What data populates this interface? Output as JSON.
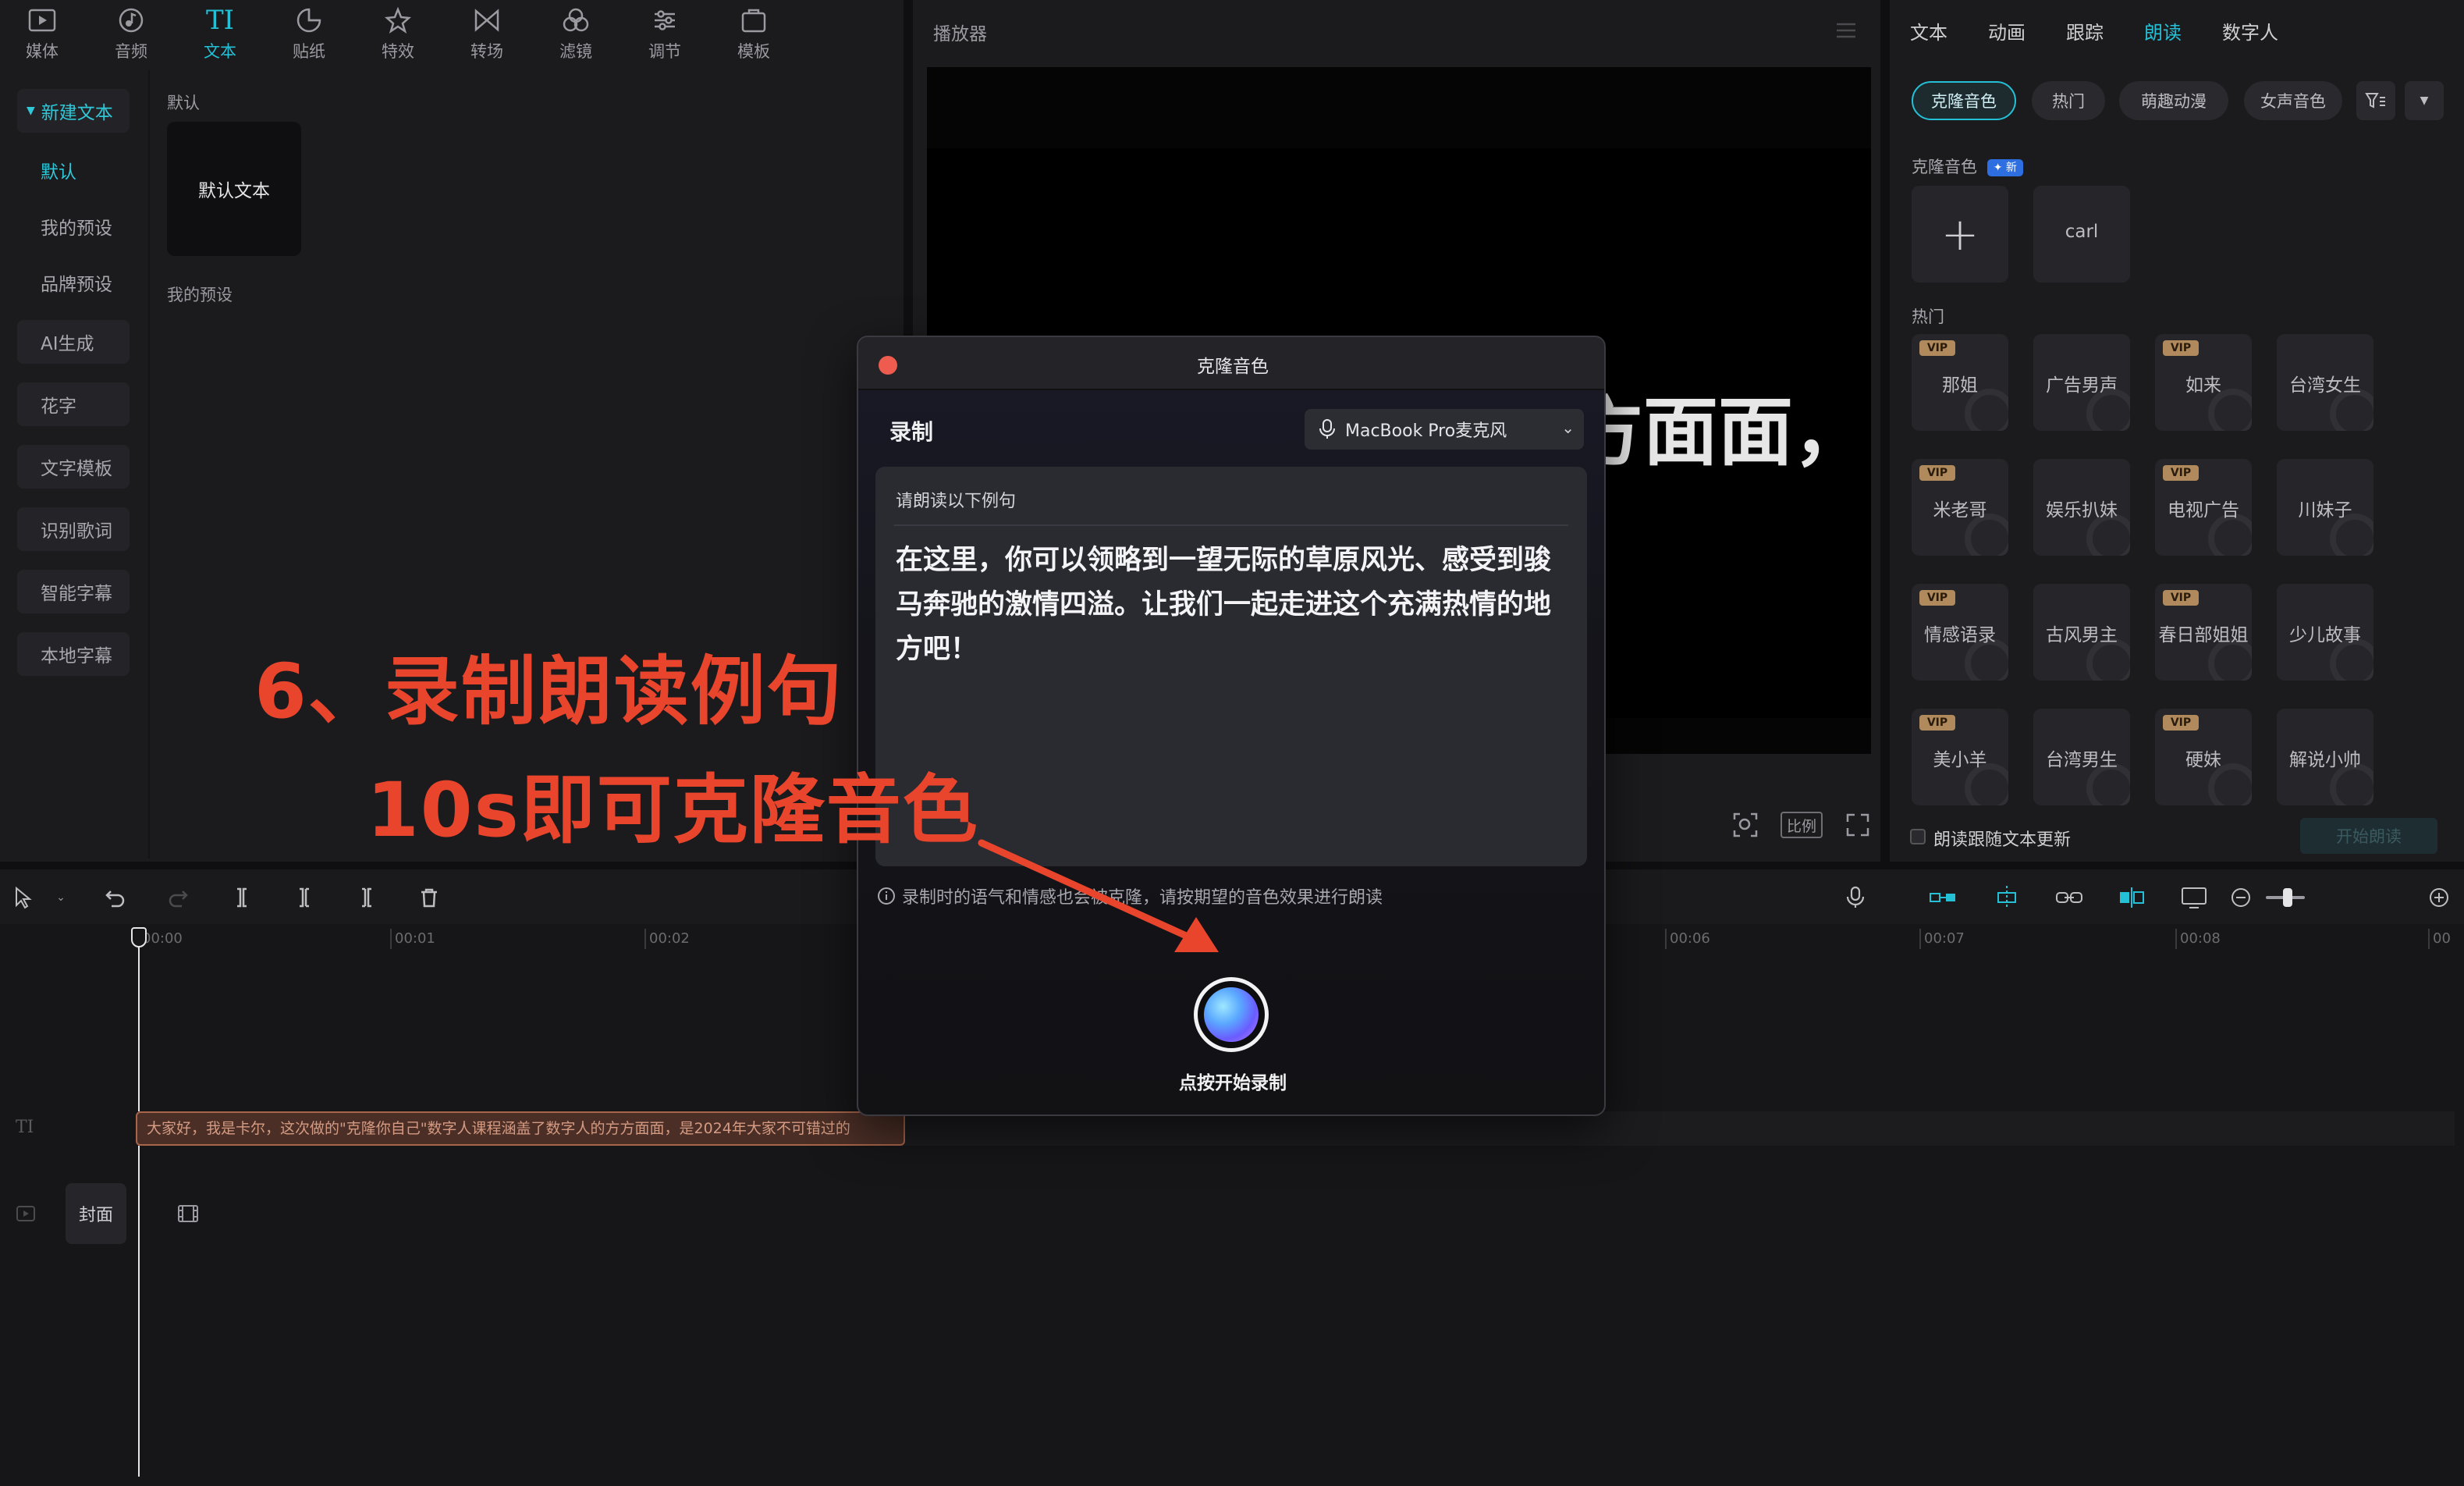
{
  "toolbar": {
    "tabs": [
      {
        "label": "媒体",
        "icon": "media-icon"
      },
      {
        "label": "音频",
        "icon": "audio-icon"
      },
      {
        "label": "文本",
        "icon": "text-icon"
      },
      {
        "label": "贴纸",
        "icon": "sticker-icon"
      },
      {
        "label": "特效",
        "icon": "effects-icon"
      },
      {
        "label": "转场",
        "icon": "transition-icon"
      },
      {
        "label": "滤镜",
        "icon": "filter-icon"
      },
      {
        "label": "调节",
        "icon": "adjust-icon"
      },
      {
        "label": "模板",
        "icon": "template-icon"
      }
    ],
    "active_index": 2
  },
  "left_nav": {
    "items": [
      "新建文本",
      "默认",
      "我的预设",
      "品牌预设",
      "AI生成",
      "花字",
      "文字模板",
      "识别歌词",
      "智能字幕",
      "本地字幕"
    ]
  },
  "text_panel": {
    "section_default": "默认",
    "default_card": "默认文本",
    "section_presets": "我的预设"
  },
  "player": {
    "title": "播放器",
    "overlay_text": "方面面，",
    "ratio_label": "比例"
  },
  "right_panel": {
    "tabs": [
      "文本",
      "动画",
      "跟踪",
      "朗读",
      "数字人"
    ],
    "active_tab": 3,
    "chips": [
      "克隆音色",
      "热门",
      "萌趣动漫",
      "女声音色"
    ],
    "clone_label": "克隆音色",
    "new_badge": "新",
    "add_symbol": "+",
    "clone_voice": "carl",
    "hot_label": "热门",
    "vip_label": "VIP",
    "voices": [
      {
        "name": "那姐",
        "vip": true
      },
      {
        "name": "广告男声",
        "vip": false
      },
      {
        "name": "如来",
        "vip": true
      },
      {
        "name": "台湾女生",
        "vip": false
      },
      {
        "name": "米老哥",
        "vip": true
      },
      {
        "name": "娱乐扒妹",
        "vip": false
      },
      {
        "name": "电视广告",
        "vip": true
      },
      {
        "name": "川妹子",
        "vip": false
      },
      {
        "name": "情感语录",
        "vip": true
      },
      {
        "name": "古风男主",
        "vip": false
      },
      {
        "name": "春日部姐姐",
        "vip": true
      },
      {
        "name": "少儿故事",
        "vip": false
      },
      {
        "name": "美小羊",
        "vip": true
      },
      {
        "name": "台湾男生",
        "vip": false
      },
      {
        "name": "硬妹",
        "vip": true
      },
      {
        "name": "解说小帅",
        "vip": false
      }
    ],
    "follow_text": "朗读跟随文本更新",
    "start_button": "开始朗读"
  },
  "timeline": {
    "ticks": [
      "00:00",
      "00:01",
      "00:02",
      "00:06",
      "00:07",
      "00:08",
      "00"
    ],
    "text_track_label": "TI",
    "subtitle_clip": "大家好，我是卡尔，这次做的\"克隆你自己\"数字人课程涵盖了数字人的方方面面，是2024年大家不可错过的",
    "cover_label": "封面"
  },
  "dialog": {
    "title": "克隆音色",
    "record_label": "录制",
    "mic_device": "MacBook Pro麦克风",
    "prompt_label": "请朗读以下例句",
    "sample_text": "在这里，你可以领略到一望无际的草原风光、感受到骏马奔驰的激情四溢。让我们一起走进这个充满热情的地方吧！",
    "hint": "录制时的语气和情感也会被克隆，请按期望的音色效果进行朗读",
    "record_button": "点按开始录制"
  },
  "annotation": {
    "line1": "6、录制朗读例句",
    "line2": "10s即可克隆音色",
    "color": "#e8452c"
  },
  "colors": {
    "accent": "#24c0d6",
    "annotation": "#e8452c",
    "vip": "#b08a5c"
  }
}
